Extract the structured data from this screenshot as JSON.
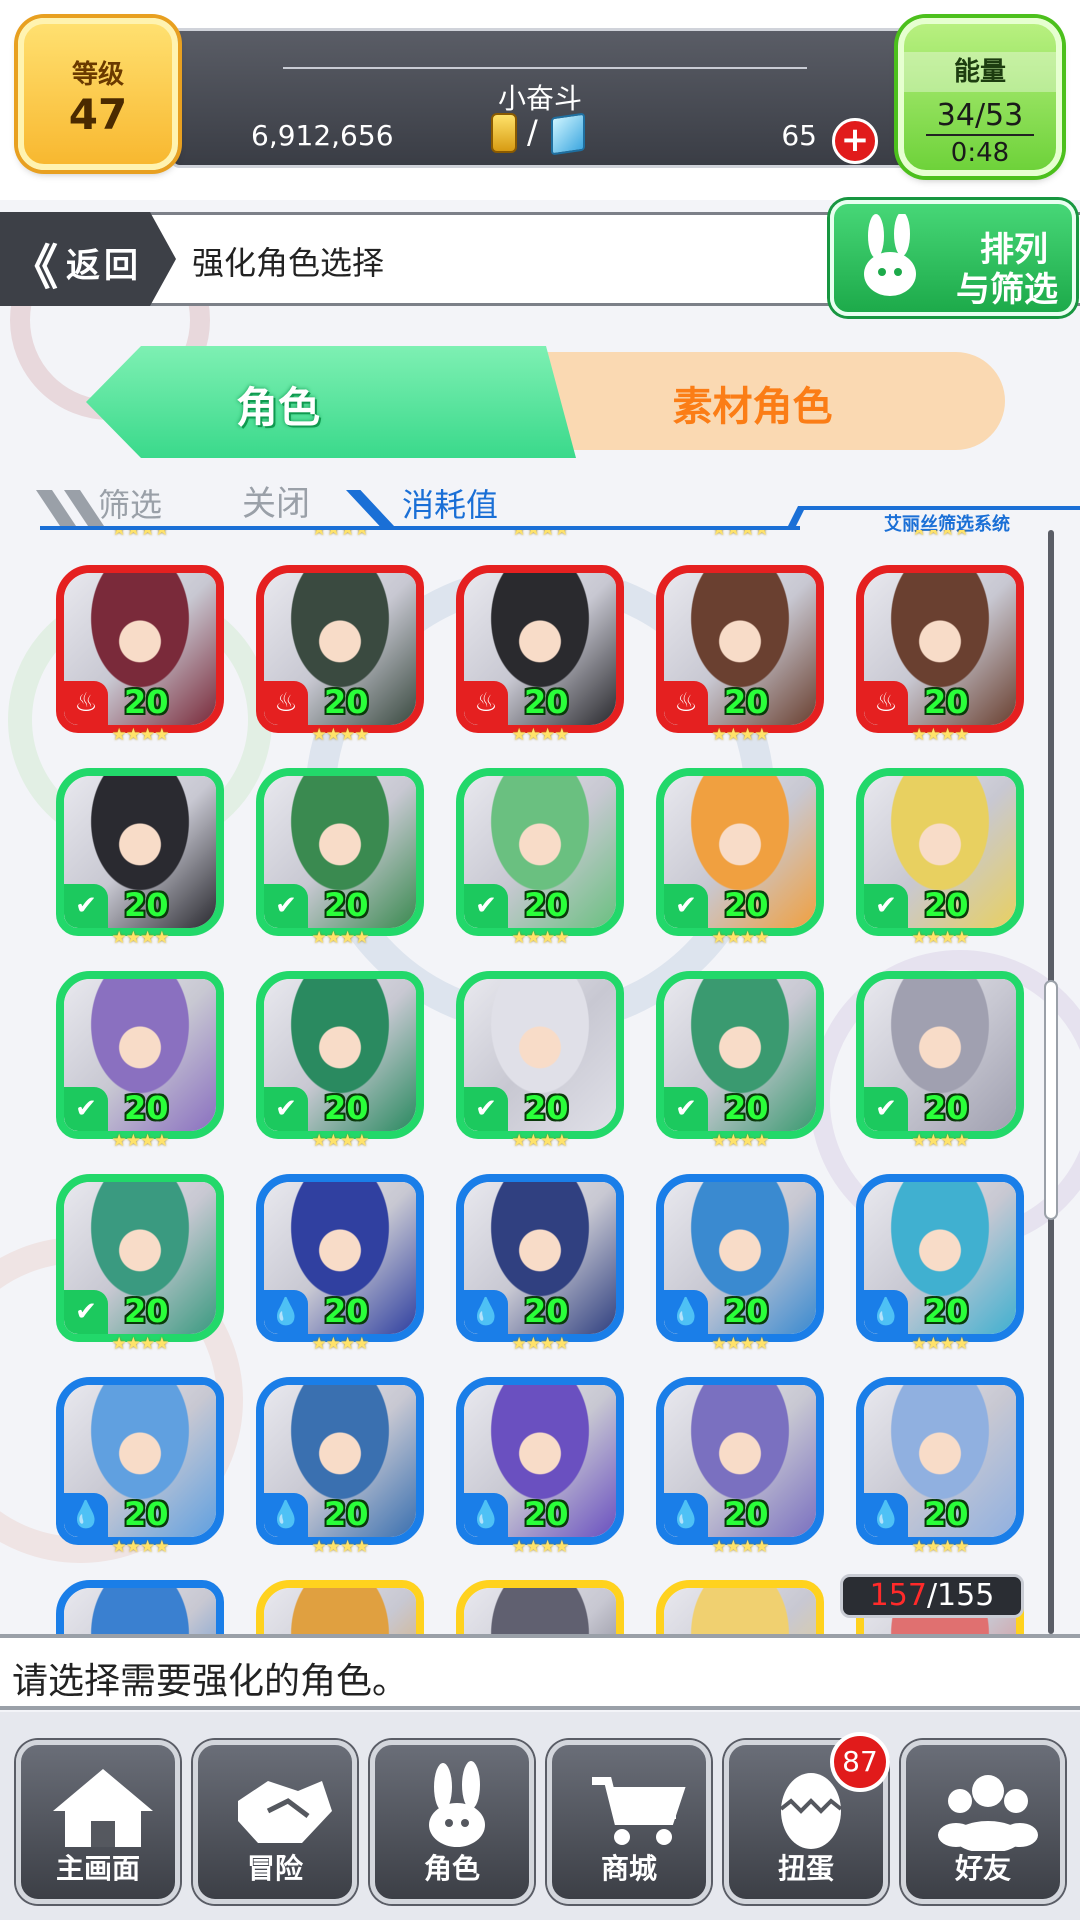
{
  "header": {
    "level_label": "等级",
    "level_value": "47",
    "player_name": "小奋斗",
    "gold": "6,912,656",
    "gems": "65",
    "energy_label": "能量",
    "energy_value": "34/53",
    "energy_timer": "0:48"
  },
  "subheader": {
    "back_label": "返回",
    "back_arrow": "《",
    "title": "强化角色选择",
    "sort_line1": "排列",
    "sort_line2": "与筛选"
  },
  "tabs": {
    "main": "角色",
    "sub": "素材角色"
  },
  "filter": {
    "label": "筛选",
    "state": "关闭",
    "sort_key": "消耗值",
    "system": "艾丽丝筛选系统"
  },
  "cards": [
    {
      "attr": "fire",
      "cost": "20"
    },
    {
      "attr": "fire",
      "cost": "20"
    },
    {
      "attr": "fire",
      "cost": "20"
    },
    {
      "attr": "fire",
      "cost": "20"
    },
    {
      "attr": "fire",
      "cost": "20"
    },
    {
      "attr": "wood",
      "cost": "20"
    },
    {
      "attr": "wood",
      "cost": "20"
    },
    {
      "attr": "wood",
      "cost": "20"
    },
    {
      "attr": "wood",
      "cost": "20"
    },
    {
      "attr": "wood",
      "cost": "20"
    },
    {
      "attr": "wood",
      "cost": "20"
    },
    {
      "attr": "wood",
      "cost": "20"
    },
    {
      "attr": "wood",
      "cost": "20"
    },
    {
      "attr": "wood",
      "cost": "20"
    },
    {
      "attr": "wood",
      "cost": "20"
    },
    {
      "attr": "wood",
      "cost": "20"
    },
    {
      "attr": "water",
      "cost": "20"
    },
    {
      "attr": "water",
      "cost": "20"
    },
    {
      "attr": "water",
      "cost": "20"
    },
    {
      "attr": "water",
      "cost": "20"
    },
    {
      "attr": "water",
      "cost": "20"
    },
    {
      "attr": "water",
      "cost": "20"
    },
    {
      "attr": "water",
      "cost": "20"
    },
    {
      "attr": "water",
      "cost": "20"
    },
    {
      "attr": "water",
      "cost": "20"
    },
    {
      "attr": "water",
      "cost": ""
    },
    {
      "attr": "light",
      "cost": ""
    },
    {
      "attr": "light",
      "cost": ""
    },
    {
      "attr": "light",
      "cost": ""
    },
    {
      "attr": "light",
      "cost": ""
    }
  ],
  "star_glyphs": "★★★★",
  "count": {
    "current": "157",
    "max": "155"
  },
  "message": "请选择需要强化的角色。",
  "nav": [
    {
      "label": "主画面",
      "icon": "home-icon"
    },
    {
      "label": "冒险",
      "icon": "handshake-icon"
    },
    {
      "label": "角色",
      "icon": "rabbit-icon"
    },
    {
      "label": "商城",
      "icon": "cart-icon"
    },
    {
      "label": "扭蛋",
      "icon": "egg-icon"
    },
    {
      "label": "好友",
      "icon": "friends-icon"
    }
  ],
  "gacha_badge": "87",
  "colors": {
    "fire": "#e52020",
    "wood": "#22d86a",
    "water": "#1a7ee8",
    "light": "#ffd21e",
    "accent_blue": "#1a6fd6",
    "cost_green": "#2aff3a"
  }
}
